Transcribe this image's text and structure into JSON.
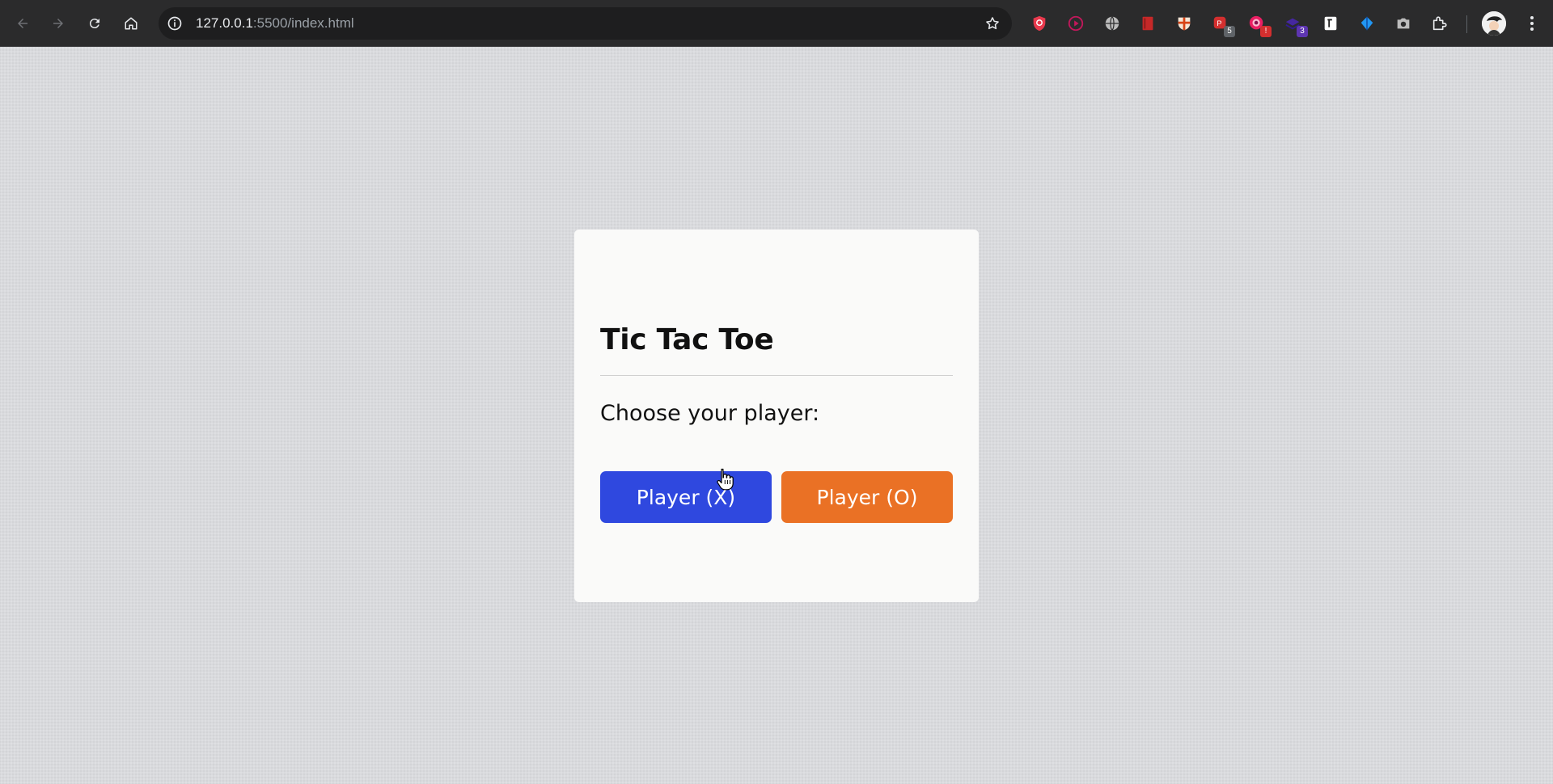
{
  "browser": {
    "url_host": "127.0.0.1",
    "url_rest": ":5500/index.html",
    "extensions": [
      {
        "icon": "shield-ext-icon",
        "color": "#e8394d"
      },
      {
        "icon": "play-circle-ext-icon",
        "color": "#c2185b"
      },
      {
        "icon": "globe-ext-icon",
        "color": "#bdbdbd"
      },
      {
        "icon": "book-ext-icon",
        "color": "#c62828"
      },
      {
        "icon": "crest-ext-icon",
        "color": "#d84315"
      },
      {
        "icon": "red-app-ext-icon",
        "color": "#d32f2f",
        "badge": "5",
        "badge_color": "#5f6368"
      },
      {
        "icon": "pinwheel-ext-icon",
        "color": "#e91e63",
        "badge": "!",
        "badge_color": "#d32f2f"
      },
      {
        "icon": "stack-ext-icon",
        "color": "#4527a0",
        "badge": "3",
        "badge_color": "#5e35b1"
      },
      {
        "icon": "notion-ext-icon",
        "color": "#ffffff"
      },
      {
        "icon": "diamond-ext-icon",
        "color": "#2196f3"
      },
      {
        "icon": "camera-ext-icon",
        "color": "#bdbdbd"
      },
      {
        "icon": "puzzle-extensions-icon",
        "color": "#e8eaed"
      }
    ]
  },
  "game": {
    "title": "Tic Tac Toe",
    "prompt": "Choose your player:",
    "player_x_label": "Player (X)",
    "player_o_label": "Player (O)"
  },
  "colors": {
    "player_x": "#2f48df",
    "player_o": "#ea7125",
    "card_bg": "#fafaf9",
    "page_bg": "#d9dadd"
  }
}
